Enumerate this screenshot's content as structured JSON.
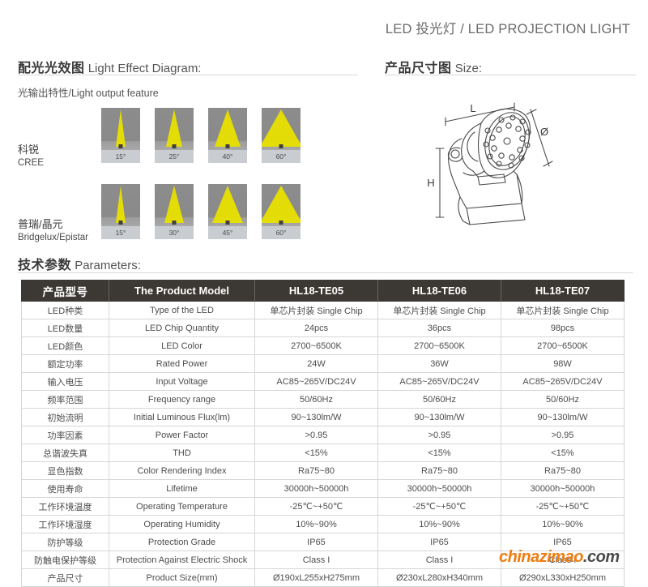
{
  "banner": {
    "title": "LED 投光灯 / LED PROJECTION LIGHT"
  },
  "light_effect": {
    "heading_cn": "配光光效图",
    "heading_en": "Light Effect Diagram:",
    "subtitle": "光输出特性/Light output feature",
    "rows": [
      {
        "brand_cn": "科锐",
        "brand_en": "CREE",
        "panels": [
          {
            "angle_label": "15°",
            "angle": 15
          },
          {
            "angle_label": "25°",
            "angle": 25
          },
          {
            "angle_label": "40°",
            "angle": 40
          },
          {
            "angle_label": "60°",
            "angle": 60
          }
        ]
      },
      {
        "brand_cn": "普瑞/晶元",
        "brand_en": "Bridgelux/Epistar",
        "panels": [
          {
            "angle_label": "15°",
            "angle": 15
          },
          {
            "angle_label": "30°",
            "angle": 30
          },
          {
            "angle_label": "45°",
            "angle": 45
          },
          {
            "angle_label": "60°",
            "angle": 60
          }
        ]
      }
    ],
    "colors": {
      "beam": "#e8e000",
      "scene_bg": "#8b8b8b",
      "caption_bg": "#c9ccd1"
    }
  },
  "size": {
    "heading_cn": "产品尺寸图",
    "heading_en": "Size:",
    "dimension_labels": {
      "length": "L",
      "diameter": "Ø",
      "height": "H"
    }
  },
  "parameters": {
    "heading_cn": "技术参数",
    "heading_en": "Parameters:",
    "headers": [
      "产品型号",
      "The Product Model",
      "HL18-TE05",
      "HL18-TE06",
      "HL18-TE07"
    ],
    "rows": [
      [
        "LED种类",
        "Type of the LED",
        "单芯片封装 Single Chip",
        "单芯片封装 Single Chip",
        "单芯片封装 Single Chip"
      ],
      [
        "LED数量",
        "LED Chip Quantity",
        "24pcs",
        "36pcs",
        "98pcs"
      ],
      [
        "LED颜色",
        "LED Color",
        "2700~6500K",
        "2700~6500K",
        "2700~6500K"
      ],
      [
        "额定功率",
        "Rated Power",
        "24W",
        "36W",
        "98W"
      ],
      [
        "输入电压",
        "Input Voltage",
        "AC85~265V/DC24V",
        "AC85~265V/DC24V",
        "AC85~265V/DC24V"
      ],
      [
        "频率范围",
        "Frequency range",
        "50/60Hz",
        "50/60Hz",
        "50/60Hz"
      ],
      [
        "初始流明",
        "Initial Luminous Flux(lm)",
        "90~130lm/W",
        "90~130lm/W",
        "90~130lm/W"
      ],
      [
        "功率因素",
        "Power Factor",
        ">0.95",
        ">0.95",
        ">0.95"
      ],
      [
        "总谐波失真",
        "THD",
        "<15%",
        "<15%",
        "<15%"
      ],
      [
        "显色指数",
        "Color Rendering Index",
        "Ra75~80",
        "Ra75~80",
        "Ra75~80"
      ],
      [
        "使用寿命",
        "Lifetime",
        "30000h~50000h",
        "30000h~50000h",
        "30000h~50000h"
      ],
      [
        "工作环境温度",
        "Operating Temperature",
        "-25℃~+50℃",
        "-25℃~+50℃",
        "-25℃~+50℃"
      ],
      [
        "工作环境湿度",
        "Operating Humidity",
        "10%~90%",
        "10%~90%",
        "10%~90%"
      ],
      [
        "防护等级",
        "Protection Grade",
        "IP65",
        "IP65",
        "IP65"
      ],
      [
        "防触电保护等级",
        "Protection Against Electric Shock",
        "Class I",
        "Class I",
        "Class I"
      ],
      [
        "产品尺寸",
        "Product Size(mm)",
        "Ø190xL255xH275mm",
        "Ø230xL280xH340mm",
        "Ø290xL330xH250mm"
      ]
    ]
  },
  "watermark": {
    "text_accent": "chinazimao",
    "text_plain": ".com",
    "accent_color": "#ef7c11"
  }
}
